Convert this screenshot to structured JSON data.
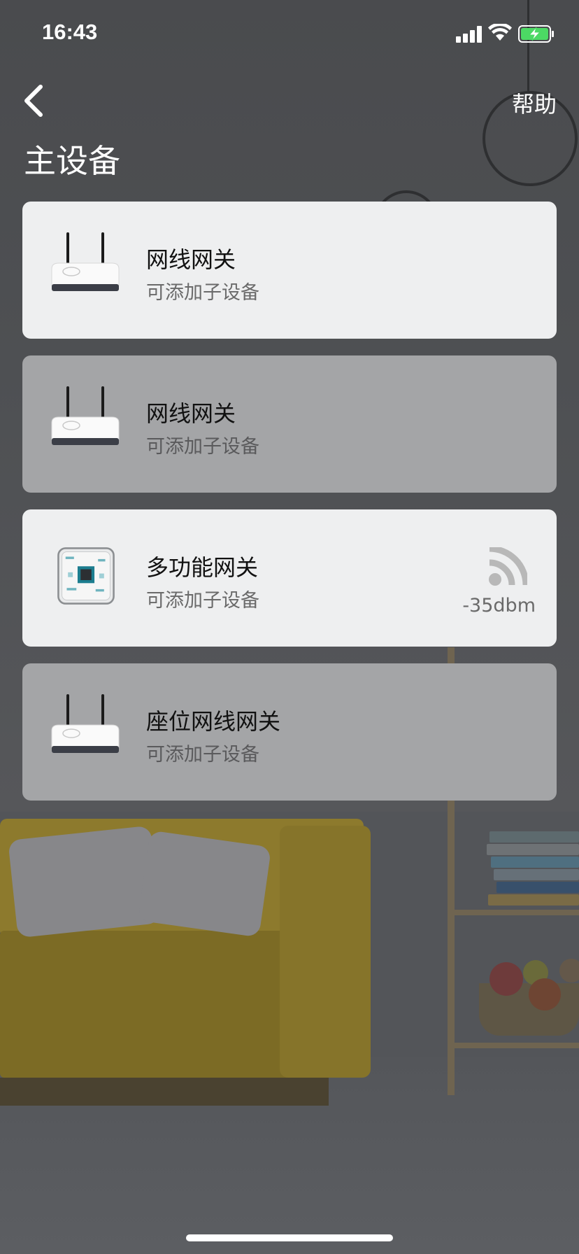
{
  "status_bar": {
    "time": "16:43"
  },
  "header": {
    "help_label": "帮助",
    "title": "主设备"
  },
  "devices": [
    {
      "name": "网线网关",
      "subtitle": "可添加子设备",
      "icon": "router-icon",
      "state": "available"
    },
    {
      "name": "网线网关",
      "subtitle": "可添加子设备",
      "icon": "router-icon",
      "state": "dimmed"
    },
    {
      "name": "多功能网关",
      "subtitle": "可添加子设备",
      "icon": "hub-icon",
      "state": "available",
      "signal": "-35dbm"
    },
    {
      "name": "座位网线网关",
      "subtitle": "可添加子设备",
      "icon": "router-icon",
      "state": "dimmed"
    }
  ],
  "colors": {
    "card_light": "#eeeff0",
    "card_dim": "#a4a5a7",
    "battery_charge": "#4cd964"
  }
}
